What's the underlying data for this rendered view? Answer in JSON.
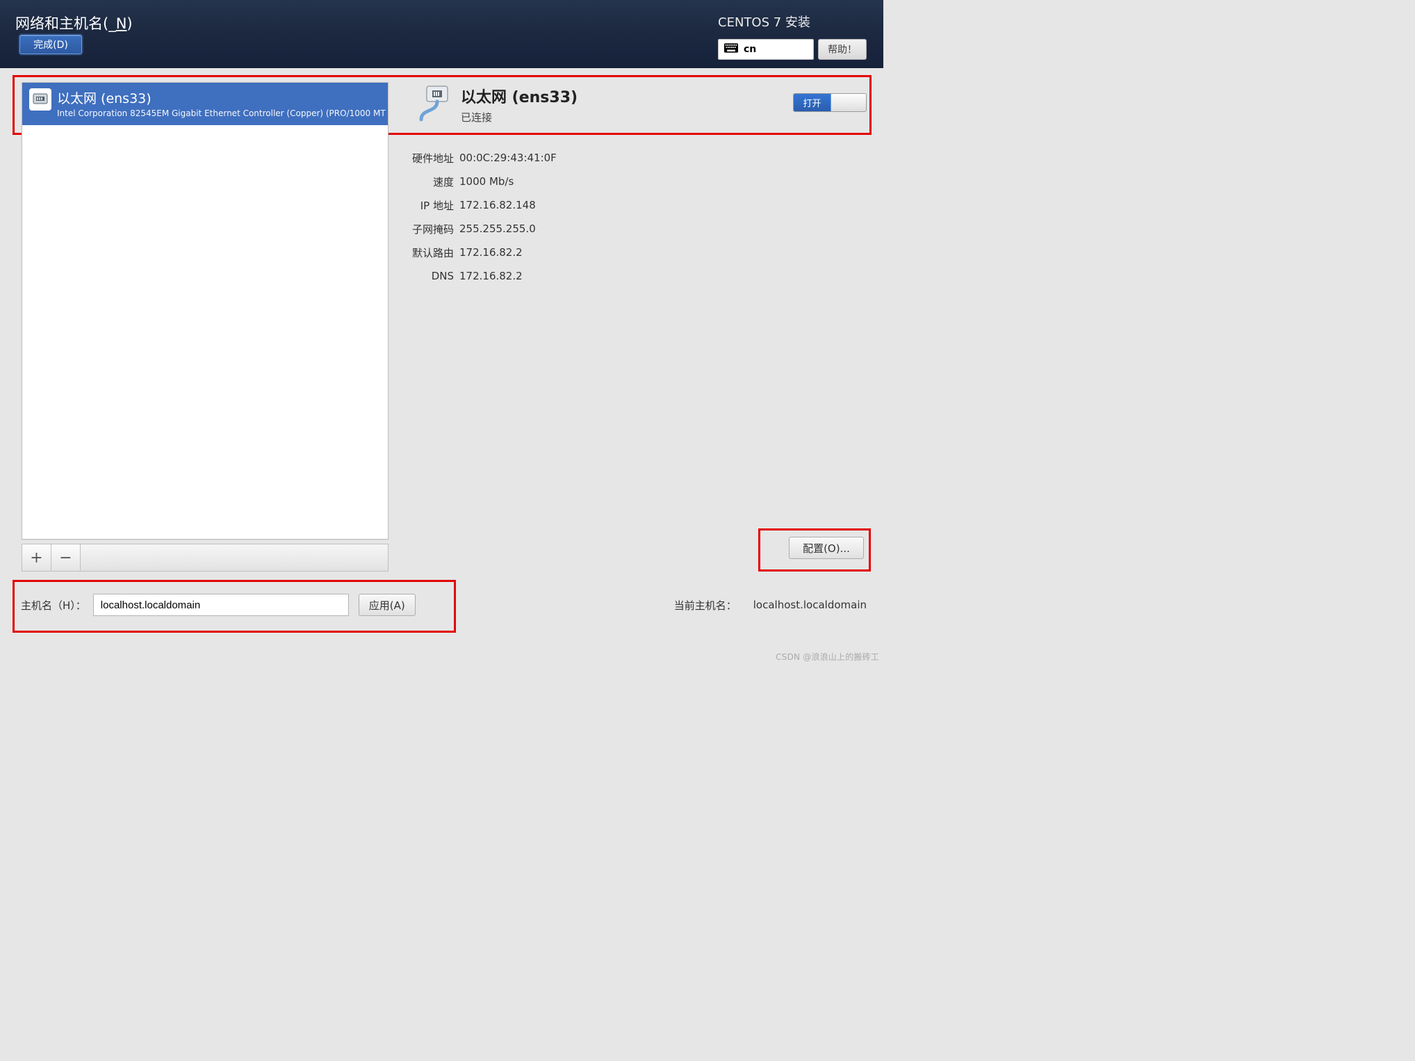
{
  "header": {
    "title_prefix": "网络和主机名(_",
    "title_mnemonic": "N",
    "title_suffix": ")",
    "done_label": "完成(D)",
    "subtitle": "CENTOS 7 安装",
    "keyboard_layout": "cn",
    "help_label": "帮助！"
  },
  "device_list": {
    "items": [
      {
        "name": "以太网 (ens33)",
        "subtitle": "Intel Corporation 82545EM Gigabit Ethernet Controller (Copper) (PRO/1000 MT",
        "selected": true
      }
    ],
    "add_label": "+",
    "remove_label": "−"
  },
  "detail": {
    "title": "以太网 (ens33)",
    "status": "已连接",
    "toggle_on_label": "打开",
    "rows": [
      {
        "label": "硬件地址",
        "value": "00:0C:29:43:41:0F"
      },
      {
        "label": "速度",
        "value": "1000 Mb/s"
      },
      {
        "label": "IP 地址",
        "value": "172.16.82.148"
      },
      {
        "label": "子网掩码",
        "value": "255.255.255.0"
      },
      {
        "label": "默认路由",
        "value": "172.16.82.2"
      },
      {
        "label": "DNS",
        "value": "172.16.82.2"
      }
    ],
    "configure_label": "配置(O)..."
  },
  "hostname": {
    "label": "主机名（H）：",
    "value": "localhost.localdomain",
    "apply_label": "应用(A)",
    "current_label": "当前主机名：",
    "current_value": "localhost.localdomain"
  },
  "watermark": "CSDN @浪浪山上的搬砖工"
}
